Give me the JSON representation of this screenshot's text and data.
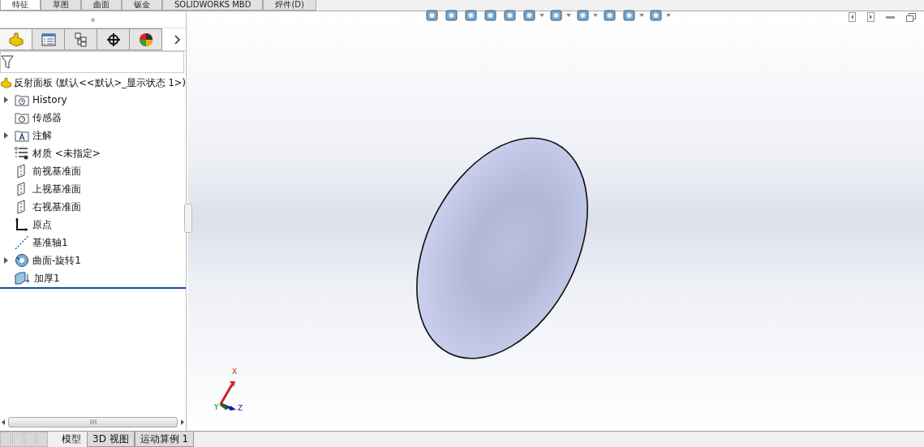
{
  "command_tabs": [
    {
      "label": "特征",
      "selected": true
    },
    {
      "label": "草图",
      "selected": false
    },
    {
      "label": "曲面",
      "selected": false
    },
    {
      "label": "钣金",
      "selected": false
    },
    {
      "label": "SOLIDWORKS MBD",
      "selected": false
    },
    {
      "label": "焊件(D)",
      "selected": false
    }
  ],
  "manager_tabs": [
    {
      "kind": "feature",
      "selected": true
    },
    {
      "kind": "property",
      "selected": false
    },
    {
      "kind": "config",
      "selected": false
    },
    {
      "kind": "dim",
      "selected": false
    },
    {
      "kind": "display",
      "selected": false
    }
  ],
  "tree": {
    "root": "反射面板  (默认<<默认>_显示状态 1>)",
    "items": [
      {
        "label": "History",
        "kind": "history",
        "expandable": true
      },
      {
        "label": "传感器",
        "kind": "sensor",
        "expandable": false
      },
      {
        "label": "注解",
        "kind": "annotation",
        "expandable": true
      },
      {
        "label": "材质 <未指定>",
        "kind": "material",
        "expandable": false
      },
      {
        "label": "前视基准面",
        "kind": "plane",
        "expandable": false
      },
      {
        "label": "上视基准面",
        "kind": "plane",
        "expandable": false
      },
      {
        "label": "右视基准面",
        "kind": "plane",
        "expandable": false
      },
      {
        "label": "原点",
        "kind": "origin",
        "expandable": false
      },
      {
        "label": "基准轴1",
        "kind": "axis",
        "expandable": false
      },
      {
        "label": "曲面-旋转1",
        "kind": "revolve",
        "expandable": true
      },
      {
        "label": "加厚1",
        "kind": "thicken",
        "expandable": false
      }
    ]
  },
  "triad": {
    "x": "X",
    "y": "Y",
    "z": "Z"
  },
  "bottom_tabs": [
    {
      "label": "模型",
      "selected": true
    },
    {
      "label": "3D 视图",
      "selected": false
    },
    {
      "label": "运动算例 1",
      "selected": false
    }
  ]
}
